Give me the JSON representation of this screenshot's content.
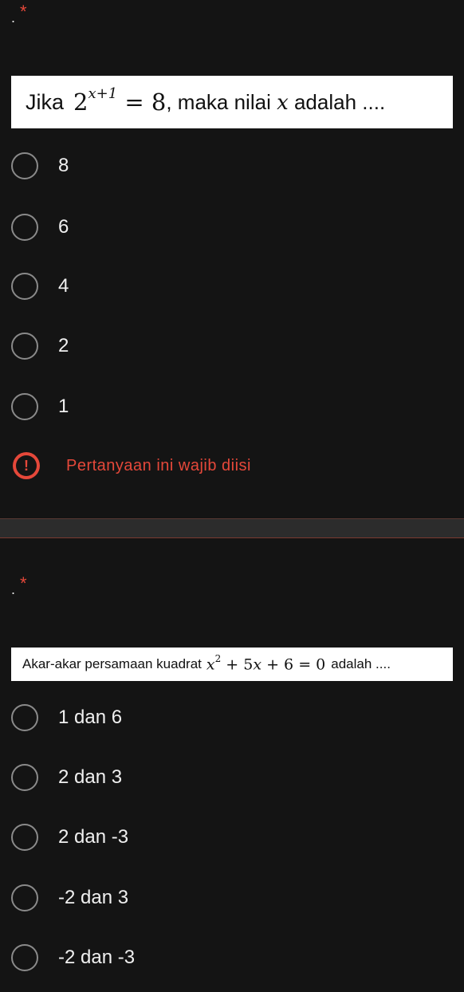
{
  "questions": [
    {
      "marker": ".",
      "required_mark": "*",
      "text_before": "Jika",
      "equation": "2x+1 = 8",
      "text_after": ", maka nilai x adalah ....",
      "options": [
        "8",
        "6",
        "4",
        "2",
        "1"
      ]
    },
    {
      "marker": ".",
      "required_mark": "*",
      "text_before": "Akar-akar persamaan kuadrat",
      "equation": "x2 + 5x + 6 = 0",
      "text_after": "adalah ....",
      "options": [
        "1 dan 6",
        "2 dan 3",
        "2 dan -3",
        "-2 dan 3",
        "-2 dan -3"
      ]
    }
  ],
  "required_message": "Pertanyaan ini wajib diisi",
  "colors": {
    "accent": "#e5483a",
    "background": "#141414",
    "radio_border": "#8a8a8a"
  }
}
